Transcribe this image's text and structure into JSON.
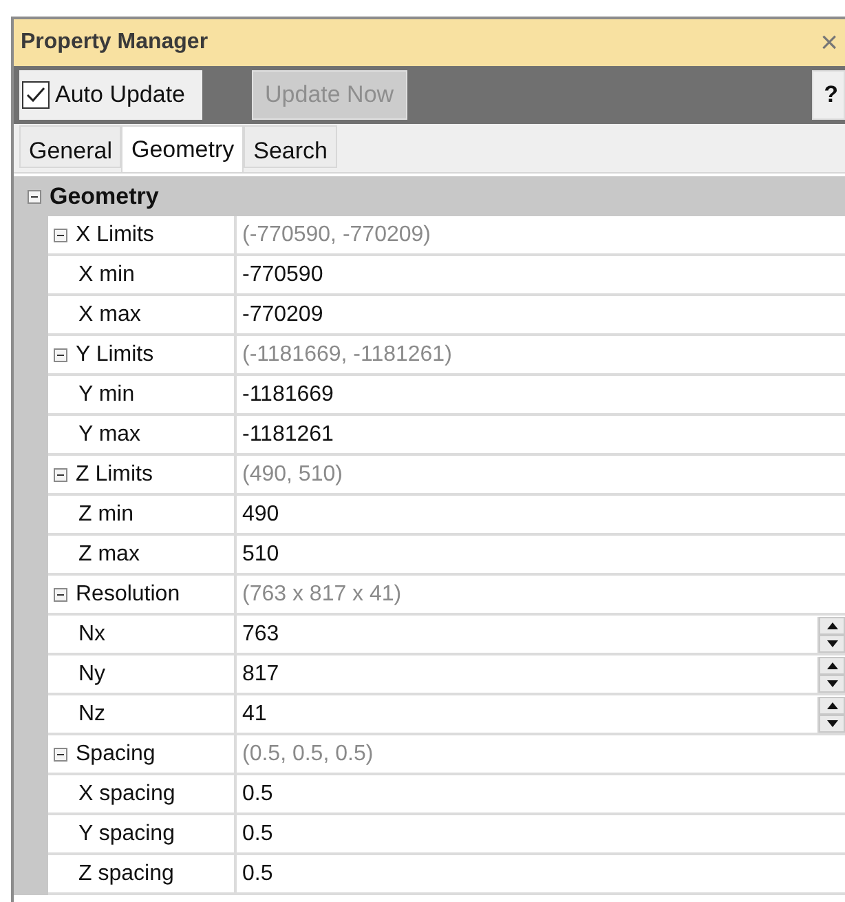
{
  "window": {
    "title": "Property Manager",
    "close": "×"
  },
  "toolbar": {
    "auto_update": {
      "label": "Auto Update",
      "checked": true
    },
    "update_now": {
      "label": "Update Now",
      "disabled": true
    },
    "help": "?"
  },
  "tabs": [
    {
      "label": "General",
      "selected": false
    },
    {
      "label": "Geometry",
      "selected": true
    },
    {
      "label": "Search",
      "selected": false
    }
  ],
  "category": {
    "label": "Geometry",
    "expanded": true,
    "groups": [
      {
        "name": "X Limits",
        "value": "(-770590, -770209)",
        "expanded": true,
        "children": [
          {
            "name": "X min",
            "value": "-770590",
            "kind": "text"
          },
          {
            "name": "X max",
            "value": "-770209",
            "kind": "text"
          }
        ]
      },
      {
        "name": "Y Limits",
        "value": "(-1181669, -1181261)",
        "expanded": true,
        "children": [
          {
            "name": "Y min",
            "value": "-1181669",
            "kind": "text"
          },
          {
            "name": "Y max",
            "value": "-1181261",
            "kind": "text"
          }
        ]
      },
      {
        "name": "Z Limits",
        "value": "(490, 510)",
        "expanded": true,
        "children": [
          {
            "name": "Z min",
            "value": "490",
            "kind": "text"
          },
          {
            "name": "Z max",
            "value": "510",
            "kind": "text"
          }
        ]
      },
      {
        "name": "Resolution",
        "value": "(763 x 817 x 41)",
        "expanded": true,
        "children": [
          {
            "name": "Nx",
            "value": "763",
            "kind": "spin"
          },
          {
            "name": "Ny",
            "value": "817",
            "kind": "spin"
          },
          {
            "name": "Nz",
            "value": "41",
            "kind": "spin"
          }
        ]
      },
      {
        "name": "Spacing",
        "value": "(0.5, 0.5, 0.5)",
        "expanded": true,
        "children": [
          {
            "name": "X spacing",
            "value": "0.5",
            "kind": "text"
          },
          {
            "name": "Y spacing",
            "value": "0.5",
            "kind": "text"
          },
          {
            "name": "Z spacing",
            "value": "0.5",
            "kind": "text"
          }
        ]
      }
    ]
  }
}
